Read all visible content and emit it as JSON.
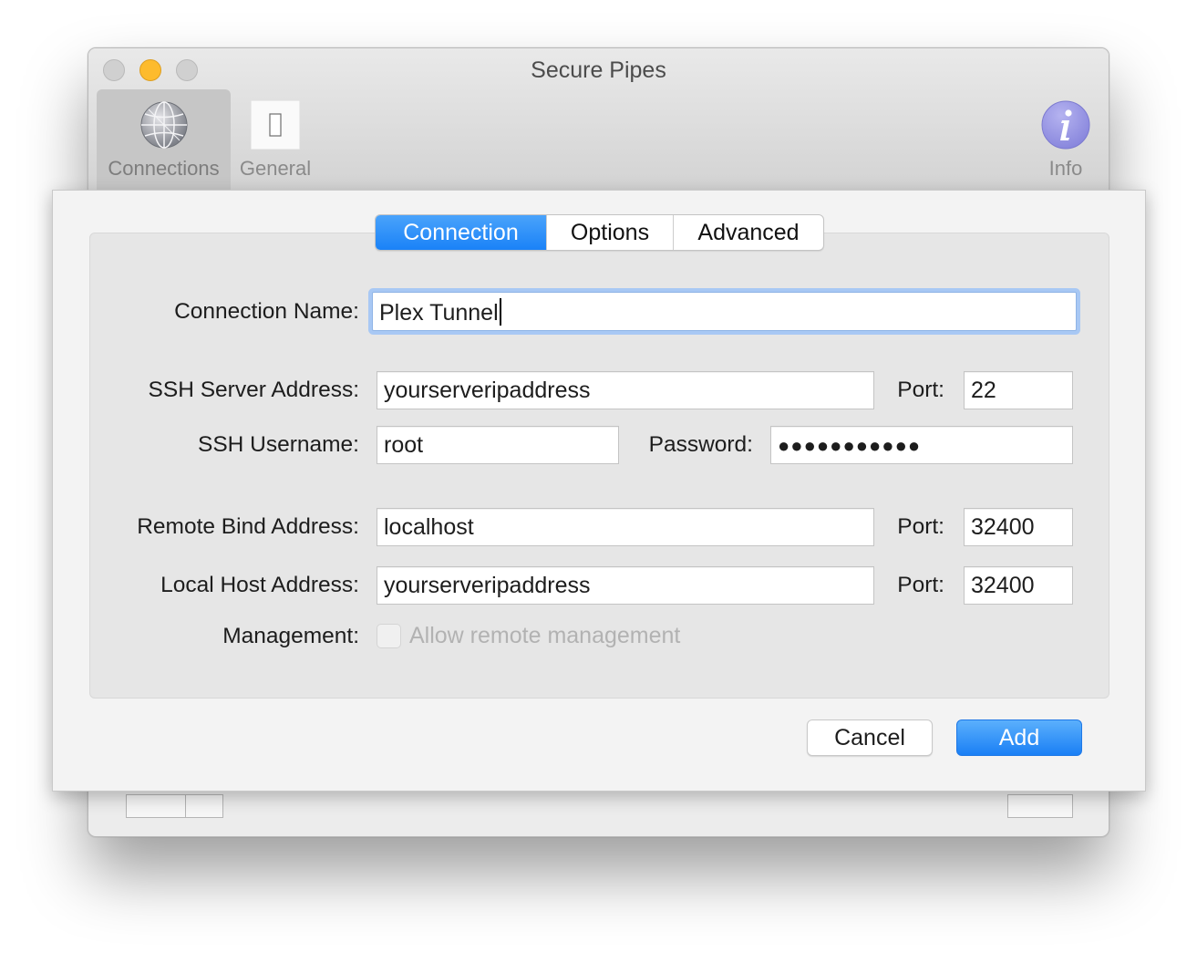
{
  "window": {
    "title": "Secure Pipes"
  },
  "toolbar": {
    "connections_label": "Connections",
    "general_label": "General",
    "info_label": "Info",
    "connections_icon": "network-globe-icon",
    "general_icon": "light-switch-icon",
    "info_icon": "info-icon"
  },
  "tabs": [
    {
      "label": "Connection",
      "active": true
    },
    {
      "label": "Options",
      "active": false
    },
    {
      "label": "Advanced",
      "active": false
    }
  ],
  "form": {
    "connection_name_label": "Connection Name:",
    "connection_name_value": "Plex Tunnel",
    "ssh_server_label": "SSH Server Address:",
    "ssh_server_value": "yourserveripaddress",
    "port_label": "Port:",
    "ssh_port_value": "22",
    "ssh_username_label": "SSH Username:",
    "ssh_username_value": "root",
    "password_label": "Password:",
    "password_value": "●●●●●●●●●●●",
    "remote_bind_label": "Remote Bind Address:",
    "remote_bind_value": "localhost",
    "remote_port_value": "32400",
    "local_host_label": "Local Host Address:",
    "local_host_value": "yourserveripaddress",
    "local_port_value": "32400",
    "management_label": "Management:",
    "allow_remote_label": "Allow remote management",
    "allow_remote_checked": false
  },
  "buttons": {
    "cancel_label": "Cancel",
    "add_label": "Add"
  },
  "colors": {
    "accent": "#1a82f7",
    "minimize": "#fdbb2d",
    "focus_ring": "#a8c8f4"
  }
}
